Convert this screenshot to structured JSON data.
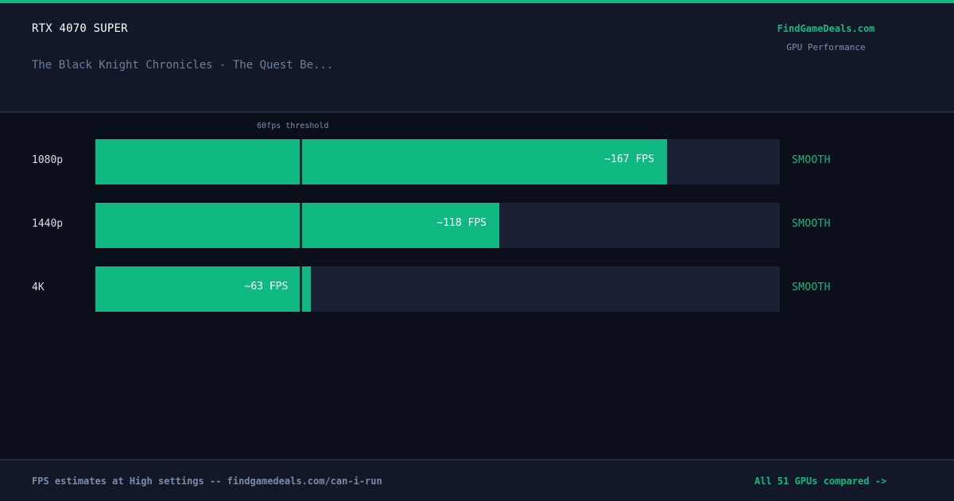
{
  "theme": {
    "accent": "#10b981",
    "bar_track": "#1a2134",
    "background": "#0b0f19",
    "panel": "#121828"
  },
  "header": {
    "gpu_name": "RTX 4070 SUPER",
    "game_title": "The Black Knight Chronicles - The Quest Be...",
    "brand": "FindGameDeals.com",
    "subtitle": "GPU Performance"
  },
  "chart_data": {
    "type": "bar",
    "orientation": "horizontal",
    "categories": [
      "1080p",
      "1440p",
      "4K"
    ],
    "values": [
      167,
      118,
      63
    ],
    "value_labels": [
      "~167 FPS",
      "~118 FPS",
      "~63 FPS"
    ],
    "statuses": [
      "SMOOTH",
      "SMOOTH",
      "SMOOTH"
    ],
    "xlim": [
      0,
      200
    ],
    "threshold": {
      "value": 60,
      "label": "60fps threshold"
    }
  },
  "footer": {
    "note": "FPS estimates at High settings -- findgamedeals.com/can-i-run",
    "link": "All 51 GPUs compared ->"
  }
}
